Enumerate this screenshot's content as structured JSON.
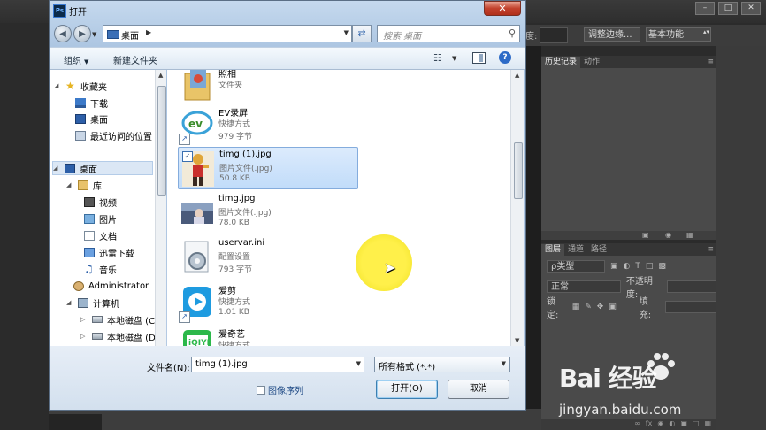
{
  "photoshop": {
    "options_bar": {
      "label_fragment": "度:",
      "refine_edge_button": "调整边缘...",
      "workspace_select": "基本功能"
    },
    "history_panel": {
      "tabs": [
        "历史记录",
        "动作"
      ]
    },
    "layers_panel": {
      "tabs": [
        "图层",
        "通道",
        "路径"
      ],
      "filter_kind": "ρ类型",
      "blend_mode": "正常",
      "opacity_label": "不透明度:",
      "lock_label": "锁定:",
      "fill_label": "填充:"
    }
  },
  "dialog": {
    "title": "打开",
    "address": {
      "location": "桌面"
    },
    "search": {
      "placeholder": "搜索 桌面"
    },
    "toolbar": {
      "organize": "组织",
      "new_folder": "新建文件夹"
    },
    "nav": [
      {
        "label": "收藏夹",
        "icon": "star-icon"
      },
      {
        "label": "下载",
        "icon": "downloads-icon"
      },
      {
        "label": "桌面",
        "icon": "desktop-icon"
      },
      {
        "label": "最近访问的位置",
        "icon": "recent-places-icon"
      },
      {
        "label": "桌面",
        "icon": "desktop-icon"
      },
      {
        "label": "库",
        "icon": "library-icon"
      },
      {
        "label": "视频",
        "icon": "video-icon"
      },
      {
        "label": "图片",
        "icon": "pictures-icon"
      },
      {
        "label": "文档",
        "icon": "documents-icon"
      },
      {
        "label": "迅雷下载",
        "icon": "thunder-download-icon"
      },
      {
        "label": "音乐",
        "icon": "music-icon"
      },
      {
        "label": "Administrator",
        "icon": "user-folder-icon"
      },
      {
        "label": "计算机",
        "icon": "computer-icon"
      },
      {
        "label": "本地磁盘 (C:)",
        "icon": "disk-icon"
      },
      {
        "label": "本地磁盘 (D:)",
        "icon": "disk-icon"
      }
    ],
    "files": [
      {
        "name": "照相",
        "type": "文件夹",
        "size": "",
        "icon": "folder-icon"
      },
      {
        "name": "EV录屏",
        "type": "快捷方式",
        "size": "979 字节",
        "icon": "ev-recorder-icon"
      },
      {
        "name": "timg (1).jpg",
        "type": "图片文件(.jpg)",
        "size": "50.8 KB",
        "icon": "image-thumbnail-icon",
        "selected": true
      },
      {
        "name": "timg.jpg",
        "type": "图片文件(.jpg)",
        "size": "78.0 KB",
        "icon": "image-thumbnail-icon"
      },
      {
        "name": "uservar.ini",
        "type": "配置设置",
        "size": "793 字节",
        "icon": "config-gear-icon"
      },
      {
        "name": "爱剪",
        "type": "快捷方式",
        "size": "1.01 KB",
        "icon": "aijian-app-icon"
      },
      {
        "name": "爱奇艺",
        "type": "快捷方式",
        "size": "",
        "icon": "iqiyi-app-icon"
      }
    ],
    "footer": {
      "filename_label": "文件名(N):",
      "filename_value": "timg (1).jpg",
      "filter_value": "所有格式 (*.*)",
      "image_sequence_label": "图像序列",
      "open_button": "打开(O)",
      "cancel_button": "取消"
    }
  },
  "watermark": {
    "brand": "Bai  经验",
    "url": "jingyan.baidu.com"
  },
  "colors": {
    "selection": "#c1dcfa",
    "close_button": "#c2412c",
    "cursor_highlight": "#fff04a"
  }
}
